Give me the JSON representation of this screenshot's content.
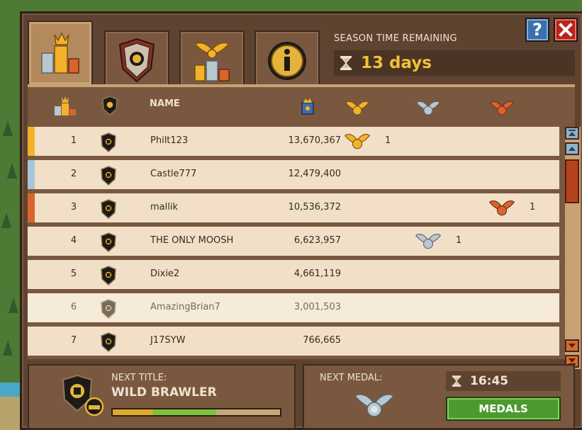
{
  "season": {
    "label": "SEASON TIME REMAINING",
    "value": "13 days"
  },
  "tabs": [
    {
      "name": "leaderboard",
      "active": true
    },
    {
      "name": "guild-shield",
      "active": false
    },
    {
      "name": "medals-podium",
      "active": false
    },
    {
      "name": "info",
      "active": false
    }
  ],
  "table": {
    "headers": {
      "name": "NAME"
    },
    "rows": [
      {
        "rank": "1",
        "name": "Philt123",
        "score": "13,670,367",
        "medal": "gold",
        "medal_count": "1",
        "stripe": "#f2b32b",
        "light": false
      },
      {
        "rank": "2",
        "name": "Castle777",
        "score": "12,479,400",
        "medal": "",
        "medal_count": "",
        "stripe": "#a8c6d6",
        "light": false
      },
      {
        "rank": "3",
        "name": "mallik",
        "score": "10,536,372",
        "medal": "bronze",
        "medal_count": "1",
        "stripe": "#d9642e",
        "light": false
      },
      {
        "rank": "4",
        "name": "THE ONLY MOOSH",
        "score": "6,623,957",
        "medal": "silver",
        "medal_count": "1",
        "stripe": "",
        "light": false
      },
      {
        "rank": "5",
        "name": "Dixie2",
        "score": "4,661,119",
        "medal": "",
        "medal_count": "",
        "stripe": "",
        "light": false
      },
      {
        "rank": "6",
        "name": "AmazingBrian7",
        "score": "3,001,503",
        "medal": "",
        "medal_count": "",
        "stripe": "",
        "light": true
      },
      {
        "rank": "7",
        "name": "J17SYW",
        "score": "766,665",
        "medal": "",
        "medal_count": "",
        "stripe": "",
        "light": false
      }
    ]
  },
  "next_title": {
    "label": "NEXT TITLE:",
    "value": "WILD BRAWLER",
    "progress": 0.62,
    "progress_gold": 0.24
  },
  "next_medal": {
    "label": "NEXT MEDAL:",
    "medal": "silver"
  },
  "timer": {
    "value": "16:45"
  },
  "medals_button": {
    "label": "MEDALS"
  },
  "colors": {
    "gold": "#f2b32b",
    "silver": "#b9c7cf",
    "bronze": "#d9642e",
    "accent_yellow": "#f2c235",
    "green_button": "#4c9a2f"
  }
}
